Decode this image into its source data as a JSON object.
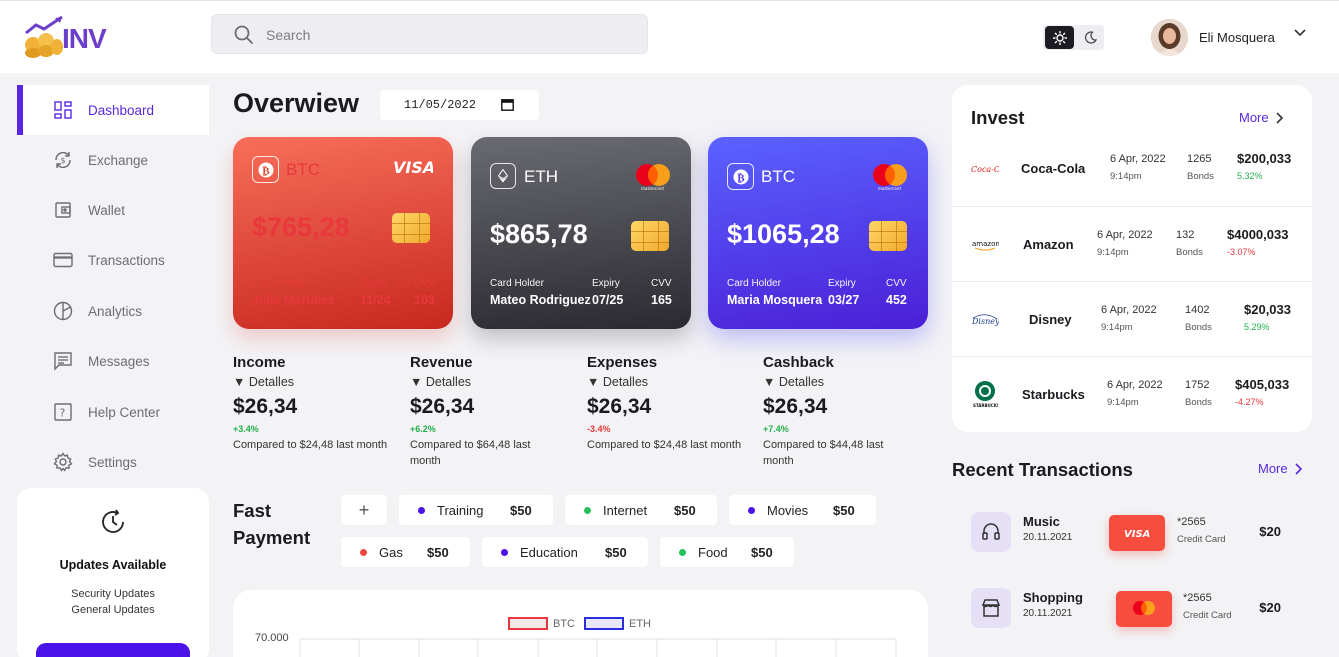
{
  "brand": {
    "logo_text": "INV"
  },
  "search": {
    "placeholder": "Search"
  },
  "user": {
    "name": "Eli Mosquera"
  },
  "sidebar": {
    "items": [
      {
        "label": "Dashboard",
        "icon": "dashboard-icon",
        "active": true
      },
      {
        "label": "Exchange",
        "icon": "exchange-icon"
      },
      {
        "label": "Wallet",
        "icon": "wallet-icon"
      },
      {
        "label": "Transactions",
        "icon": "credit-card-icon"
      },
      {
        "label": "Analytics",
        "icon": "pie-chart-icon"
      },
      {
        "label": "Messages",
        "icon": "message-icon"
      },
      {
        "label": "Help Center",
        "icon": "help-icon"
      },
      {
        "label": "Settings",
        "icon": "gear-icon"
      }
    ],
    "updates": {
      "title": "Updates Available",
      "lines": [
        "Security Updates",
        "General Updates"
      ]
    }
  },
  "overview": {
    "title": "Overwiew",
    "date": "11/05/2022"
  },
  "cards": [
    {
      "coin": "BTC",
      "brand": "VISA",
      "amount": "$765,28",
      "holder_label": "Card Holder",
      "holder": "Julia Martinez",
      "expiry_label": "Expiry",
      "expiry": "11/24",
      "cvv_label": "CVV",
      "cvv": "103"
    },
    {
      "coin": "ETH",
      "brand": "mastercard",
      "amount": "$865,78",
      "holder_label": "Card Holder",
      "holder": "Mateo Rodriguez",
      "expiry_label": "Expiry",
      "expiry": "07/25",
      "cvv_label": "CVV",
      "cvv": "165"
    },
    {
      "coin": "BTC",
      "brand": "mastercard",
      "amount": "$1065,28",
      "holder_label": "Card Holder",
      "holder": "Maria Mosquera",
      "expiry_label": "Expiry",
      "expiry": "03/27",
      "cvv_label": "CVV",
      "cvv": "452"
    }
  ],
  "stats": [
    {
      "name": "Income",
      "details": "Detalles",
      "value": "$26,34",
      "change": "+3.4%",
      "trend": "up",
      "compare": "Compared to $24,48 last month"
    },
    {
      "name": "Revenue",
      "details": "Detalles",
      "value": "$26,34",
      "change": "+6.2%",
      "trend": "up",
      "compare": "Compared to $64,48 last month"
    },
    {
      "name": "Expenses",
      "details": "Detalles",
      "value": "$26,34",
      "change": "-3.4%",
      "trend": "down",
      "compare": "Compared to $24,48 last month"
    },
    {
      "name": "Cashback",
      "details": "Detalles",
      "value": "$26,34",
      "change": "+7.4%",
      "trend": "up",
      "compare": "Compared to $44,48 last month"
    }
  ],
  "fast_payment": {
    "title_line1": "Fast",
    "title_line2": "Payment",
    "add_label": "+",
    "items": [
      {
        "label": "Training",
        "amount": "$50",
        "color": "#4a12e8"
      },
      {
        "label": "Internet",
        "amount": "$50",
        "color": "#27c05a"
      },
      {
        "label": "Movies",
        "amount": "$50",
        "color": "#4a12e8"
      },
      {
        "label": "Gas",
        "amount": "$50",
        "color": "#f2453c"
      },
      {
        "label": "Education",
        "amount": "$50",
        "color": "#4a12e8"
      },
      {
        "label": "Food",
        "amount": "$50",
        "color": "#27c05a"
      }
    ]
  },
  "chart_data": {
    "type": "bar",
    "legend": [
      "BTC",
      "ETH"
    ],
    "legend_colors": [
      "#e8383b",
      "#2d2de0"
    ],
    "y_tick_top": "70.000"
  },
  "invest": {
    "title": "Invest",
    "more_label": "More",
    "rows": [
      {
        "name": "Coca-Cola",
        "date": "6 Apr, 2022",
        "time": "9:14pm",
        "count": "1265",
        "unit": "Bonds",
        "amount": "$200,033",
        "change": "5.32%",
        "trend": "up"
      },
      {
        "name": "Amazon",
        "date": "6 Apr, 2022",
        "time": "9:14pm",
        "count": "132",
        "unit": "Bonds",
        "amount": "$4000,033",
        "change": "-3.07%",
        "trend": "down"
      },
      {
        "name": "Disney",
        "date": "6 Apr, 2022",
        "time": "9:14pm",
        "count": "1402",
        "unit": "Bonds",
        "amount": "$20,033",
        "change": "5.29%",
        "trend": "up"
      },
      {
        "name": "Starbucks",
        "date": "6 Apr, 2022",
        "time": "9:14pm",
        "count": "1752",
        "unit": "Bonds",
        "amount": "$405,033",
        "change": "-4.27%",
        "trend": "down"
      }
    ]
  },
  "recent": {
    "title": "Recent Transactions",
    "more_label": "More",
    "rows": [
      {
        "name": "Music",
        "date": "20.11.2021",
        "card_brand": "VISA",
        "card_num": "*2565",
        "card_type": "Credit Card",
        "amount": "$20"
      },
      {
        "name": "Shopping",
        "date": "20.11.2021",
        "card_brand": "mastercard",
        "card_num": "*2565",
        "card_type": "Credit Card",
        "amount": "$20"
      }
    ]
  }
}
